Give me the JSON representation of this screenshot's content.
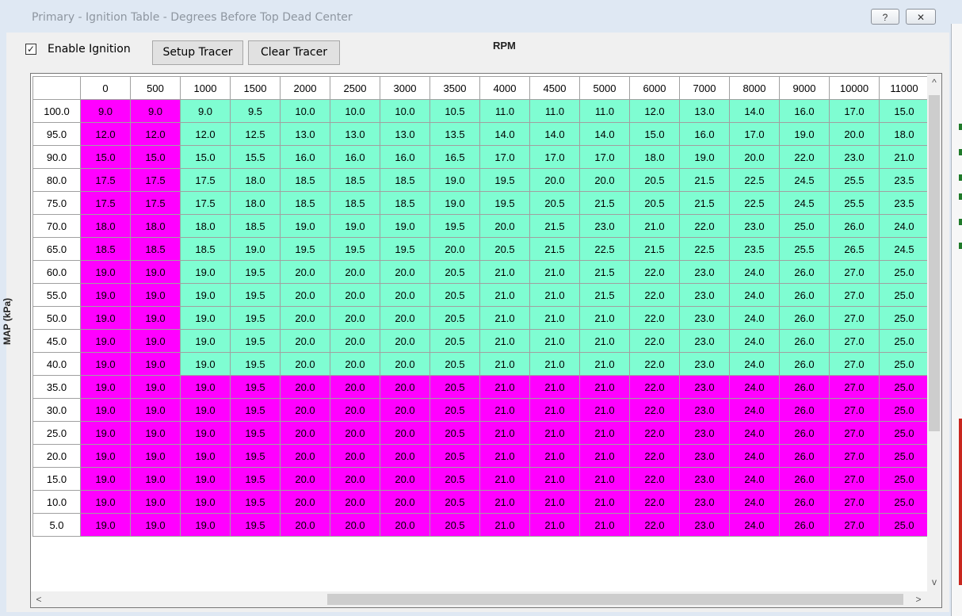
{
  "window": {
    "title": "Primary - Ignition Table - Degrees Before Top Dead Center",
    "help_glyph": "?",
    "close_glyph": "✕"
  },
  "toolbar": {
    "enable_checked": true,
    "enable_label": "Enable Ignition",
    "setup_tracer": "Setup Tracer",
    "clear_tracer": "Clear Tracer"
  },
  "axes": {
    "x_label": "RPM",
    "y_label": "MAP (kPa)"
  },
  "colors": {
    "active_cell": "#7ffdd2",
    "highlight_cell": "#ff00ff",
    "table_bg": "#ffffff"
  },
  "table": {
    "rpm": [
      "0",
      "500",
      "1000",
      "1500",
      "2000",
      "2500",
      "3000",
      "3500",
      "4000",
      "4500",
      "5000",
      "6000",
      "7000",
      "8000",
      "9000",
      "10000",
      "11000"
    ],
    "rows": [
      {
        "map": "100.0",
        "values": [
          "9.0",
          "9.0",
          "9.0",
          "9.5",
          "10.0",
          "10.0",
          "10.0",
          "10.5",
          "11.0",
          "11.0",
          "11.0",
          "12.0",
          "13.0",
          "14.0",
          "16.0",
          "17.0",
          "15.0"
        ],
        "magenta_cols": 2
      },
      {
        "map": "95.0",
        "values": [
          "12.0",
          "12.0",
          "12.0",
          "12.5",
          "13.0",
          "13.0",
          "13.0",
          "13.5",
          "14.0",
          "14.0",
          "14.0",
          "15.0",
          "16.0",
          "17.0",
          "19.0",
          "20.0",
          "18.0"
        ],
        "magenta_cols": 2
      },
      {
        "map": "90.0",
        "values": [
          "15.0",
          "15.0",
          "15.0",
          "15.5",
          "16.0",
          "16.0",
          "16.0",
          "16.5",
          "17.0",
          "17.0",
          "17.0",
          "18.0",
          "19.0",
          "20.0",
          "22.0",
          "23.0",
          "21.0"
        ],
        "magenta_cols": 2
      },
      {
        "map": "80.0",
        "values": [
          "17.5",
          "17.5",
          "17.5",
          "18.0",
          "18.5",
          "18.5",
          "18.5",
          "19.0",
          "19.5",
          "20.0",
          "20.0",
          "20.5",
          "21.5",
          "22.5",
          "24.5",
          "25.5",
          "23.5"
        ],
        "magenta_cols": 2
      },
      {
        "map": "75.0",
        "values": [
          "17.5",
          "17.5",
          "17.5",
          "18.0",
          "18.5",
          "18.5",
          "18.5",
          "19.0",
          "19.5",
          "20.5",
          "21.5",
          "20.5",
          "21.5",
          "22.5",
          "24.5",
          "25.5",
          "23.5"
        ],
        "magenta_cols": 2
      },
      {
        "map": "70.0",
        "values": [
          "18.0",
          "18.0",
          "18.0",
          "18.5",
          "19.0",
          "19.0",
          "19.0",
          "19.5",
          "20.0",
          "21.5",
          "23.0",
          "21.0",
          "22.0",
          "23.0",
          "25.0",
          "26.0",
          "24.0"
        ],
        "magenta_cols": 2
      },
      {
        "map": "65.0",
        "values": [
          "18.5",
          "18.5",
          "18.5",
          "19.0",
          "19.5",
          "19.5",
          "19.5",
          "20.0",
          "20.5",
          "21.5",
          "22.5",
          "21.5",
          "22.5",
          "23.5",
          "25.5",
          "26.5",
          "24.5"
        ],
        "magenta_cols": 2
      },
      {
        "map": "60.0",
        "values": [
          "19.0",
          "19.0",
          "19.0",
          "19.5",
          "20.0",
          "20.0",
          "20.0",
          "20.5",
          "21.0",
          "21.0",
          "21.5",
          "22.0",
          "23.0",
          "24.0",
          "26.0",
          "27.0",
          "25.0"
        ],
        "magenta_cols": 2
      },
      {
        "map": "55.0",
        "values": [
          "19.0",
          "19.0",
          "19.0",
          "19.5",
          "20.0",
          "20.0",
          "20.0",
          "20.5",
          "21.0",
          "21.0",
          "21.5",
          "22.0",
          "23.0",
          "24.0",
          "26.0",
          "27.0",
          "25.0"
        ],
        "magenta_cols": 2
      },
      {
        "map": "50.0",
        "values": [
          "19.0",
          "19.0",
          "19.0",
          "19.5",
          "20.0",
          "20.0",
          "20.0",
          "20.5",
          "21.0",
          "21.0",
          "21.0",
          "22.0",
          "23.0",
          "24.0",
          "26.0",
          "27.0",
          "25.0"
        ],
        "magenta_cols": 2
      },
      {
        "map": "45.0",
        "values": [
          "19.0",
          "19.0",
          "19.0",
          "19.5",
          "20.0",
          "20.0",
          "20.0",
          "20.5",
          "21.0",
          "21.0",
          "21.0",
          "22.0",
          "23.0",
          "24.0",
          "26.0",
          "27.0",
          "25.0"
        ],
        "magenta_cols": 2
      },
      {
        "map": "40.0",
        "values": [
          "19.0",
          "19.0",
          "19.0",
          "19.5",
          "20.0",
          "20.0",
          "20.0",
          "20.5",
          "21.0",
          "21.0",
          "21.0",
          "22.0",
          "23.0",
          "24.0",
          "26.0",
          "27.0",
          "25.0"
        ],
        "magenta_cols": 2
      },
      {
        "map": "35.0",
        "values": [
          "19.0",
          "19.0",
          "19.0",
          "19.5",
          "20.0",
          "20.0",
          "20.0",
          "20.5",
          "21.0",
          "21.0",
          "21.0",
          "22.0",
          "23.0",
          "24.0",
          "26.0",
          "27.0",
          "25.0"
        ],
        "magenta_cols": 17
      },
      {
        "map": "30.0",
        "values": [
          "19.0",
          "19.0",
          "19.0",
          "19.5",
          "20.0",
          "20.0",
          "20.0",
          "20.5",
          "21.0",
          "21.0",
          "21.0",
          "22.0",
          "23.0",
          "24.0",
          "26.0",
          "27.0",
          "25.0"
        ],
        "magenta_cols": 17
      },
      {
        "map": "25.0",
        "values": [
          "19.0",
          "19.0",
          "19.0",
          "19.5",
          "20.0",
          "20.0",
          "20.0",
          "20.5",
          "21.0",
          "21.0",
          "21.0",
          "22.0",
          "23.0",
          "24.0",
          "26.0",
          "27.0",
          "25.0"
        ],
        "magenta_cols": 17
      },
      {
        "map": "20.0",
        "values": [
          "19.0",
          "19.0",
          "19.0",
          "19.5",
          "20.0",
          "20.0",
          "20.0",
          "20.5",
          "21.0",
          "21.0",
          "21.0",
          "22.0",
          "23.0",
          "24.0",
          "26.0",
          "27.0",
          "25.0"
        ],
        "magenta_cols": 17
      },
      {
        "map": "15.0",
        "values": [
          "19.0",
          "19.0",
          "19.0",
          "19.5",
          "20.0",
          "20.0",
          "20.0",
          "20.5",
          "21.0",
          "21.0",
          "21.0",
          "22.0",
          "23.0",
          "24.0",
          "26.0",
          "27.0",
          "25.0"
        ],
        "magenta_cols": 17
      },
      {
        "map": "10.0",
        "values": [
          "19.0",
          "19.0",
          "19.0",
          "19.5",
          "20.0",
          "20.0",
          "20.0",
          "20.5",
          "21.0",
          "21.0",
          "21.0",
          "22.0",
          "23.0",
          "24.0",
          "26.0",
          "27.0",
          "25.0"
        ],
        "magenta_cols": 17
      },
      {
        "map": "5.0",
        "values": [
          "19.0",
          "19.0",
          "19.0",
          "19.5",
          "20.0",
          "20.0",
          "20.0",
          "20.5",
          "21.0",
          "21.0",
          "21.0",
          "22.0",
          "23.0",
          "24.0",
          "26.0",
          "27.0",
          "25.0"
        ],
        "magenta_cols": 17
      }
    ]
  },
  "scrollbars": {
    "up_glyph": "^",
    "down_glyph": "v",
    "left_glyph": "<",
    "right_glyph": ">"
  }
}
